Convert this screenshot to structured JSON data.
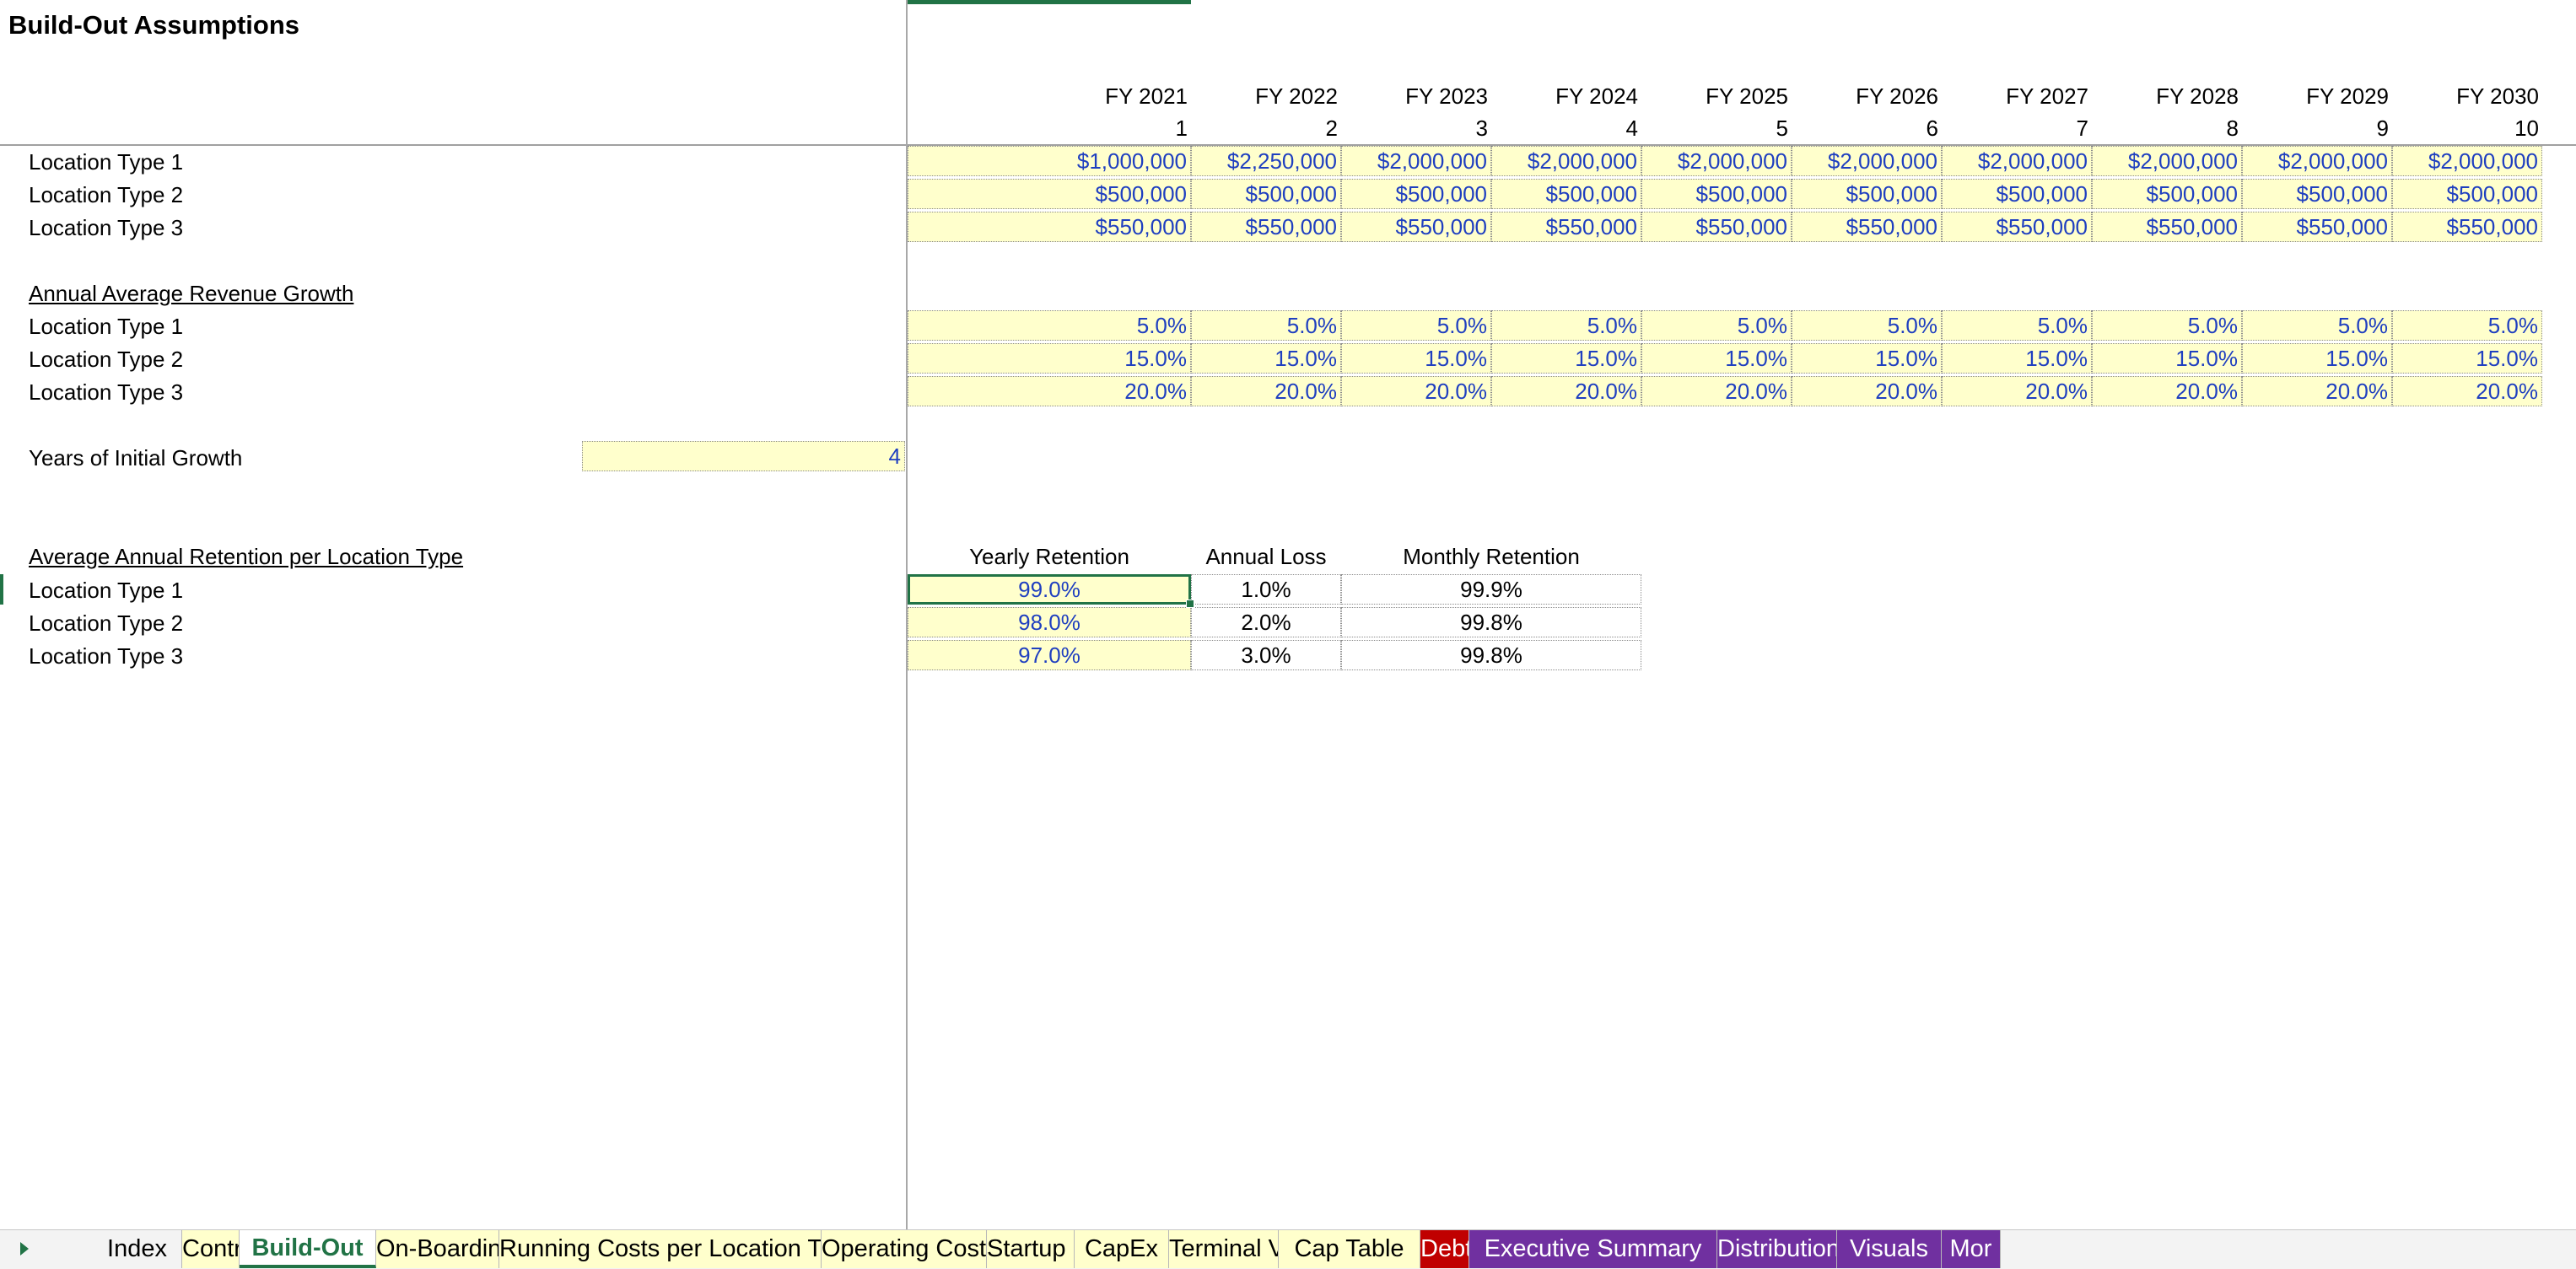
{
  "sheet": {
    "title": "Build-Out Assumptions",
    "fy_headers": [
      "FY 2021",
      "FY 2022",
      "FY 2023",
      "FY 2024",
      "FY 2025",
      "FY 2026",
      "FY 2027",
      "FY 2028",
      "FY 2029",
      "FY 2030"
    ],
    "year_numbers": [
      "1",
      "2",
      "3",
      "4",
      "5",
      "6",
      "7",
      "8",
      "9",
      "10"
    ],
    "revenue_section": {
      "rows": [
        {
          "label": "Location Type 1",
          "values": [
            "$1,000,000",
            "$2,250,000",
            "$2,000,000",
            "$2,000,000",
            "$2,000,000",
            "$2,000,000",
            "$2,000,000",
            "$2,000,000",
            "$2,000,000",
            "$2,000,000"
          ]
        },
        {
          "label": "Location Type 2",
          "values": [
            "$500,000",
            "$500,000",
            "$500,000",
            "$500,000",
            "$500,000",
            "$500,000",
            "$500,000",
            "$500,000",
            "$500,000",
            "$500,000"
          ]
        },
        {
          "label": "Location Type 3",
          "values": [
            "$550,000",
            "$550,000",
            "$550,000",
            "$550,000",
            "$550,000",
            "$550,000",
            "$550,000",
            "$550,000",
            "$550,000",
            "$550,000"
          ]
        }
      ]
    },
    "growth_section": {
      "heading": "Annual Average Revenue Growth",
      "rows": [
        {
          "label": "Location Type 1",
          "values": [
            "5.0%",
            "5.0%",
            "5.0%",
            "5.0%",
            "5.0%",
            "5.0%",
            "5.0%",
            "5.0%",
            "5.0%",
            "5.0%"
          ]
        },
        {
          "label": "Location Type 2",
          "values": [
            "15.0%",
            "15.0%",
            "15.0%",
            "15.0%",
            "15.0%",
            "15.0%",
            "15.0%",
            "15.0%",
            "15.0%",
            "15.0%"
          ]
        },
        {
          "label": "Location Type 3",
          "values": [
            "20.0%",
            "20.0%",
            "20.0%",
            "20.0%",
            "20.0%",
            "20.0%",
            "20.0%",
            "20.0%",
            "20.0%",
            "20.0%"
          ]
        }
      ]
    },
    "initial_growth": {
      "label": "Years of Initial Growth",
      "value": "4"
    },
    "retention_section": {
      "heading": "Average Annual Retention per Location Type",
      "columns": [
        "Yearly Retention",
        "Annual Loss",
        "Monthly Retention"
      ],
      "rows": [
        {
          "label": "Location Type 1",
          "yearly": "99.0%",
          "loss": "1.0%",
          "monthly": "99.9%"
        },
        {
          "label": "Location Type 2",
          "yearly": "98.0%",
          "loss": "2.0%",
          "monthly": "99.8%"
        },
        {
          "label": "Location Type 3",
          "yearly": "97.0%",
          "loss": "3.0%",
          "monthly": "99.8%"
        }
      ]
    }
  },
  "tabs": [
    {
      "label": "Index",
      "color": "#f3f3f3",
      "text": "#000000"
    },
    {
      "label": "Control",
      "color": "#ffffcc",
      "text": "#000000"
    },
    {
      "label": "Build-Out",
      "color": "#ffffff",
      "text": "#217346",
      "active": true
    },
    {
      "label": "On-Boarding Costs",
      "color": "#ffffcc",
      "text": "#000000"
    },
    {
      "label": "Running Costs per Location Type",
      "color": "#ffffcc",
      "text": "#000000"
    },
    {
      "label": "Operating Costs",
      "color": "#ffffcc",
      "text": "#000000"
    },
    {
      "label": "Startup Costs",
      "color": "#ffffcc",
      "text": "#000000"
    },
    {
      "label": "CapEx",
      "color": "#ffffcc",
      "text": "#000000"
    },
    {
      "label": "Terminal Value",
      "color": "#ffffcc",
      "text": "#000000"
    },
    {
      "label": "Cap Table",
      "color": "#ffffcc",
      "text": "#000000"
    },
    {
      "label": "Debt",
      "color": "#c00000",
      "text": "#ffffff"
    },
    {
      "label": "Executive Summary",
      "color": "#7030a0",
      "text": "#ffffff"
    },
    {
      "label": "Distributions",
      "color": "#7030a0",
      "text": "#ffffff"
    },
    {
      "label": "Visuals",
      "color": "#7030a0",
      "text": "#ffffff"
    },
    {
      "label": "Mor",
      "color": "#7030a0",
      "text": "#ffffff"
    }
  ],
  "colors": {
    "accent": "#217346",
    "input_fill": "#ffffcc",
    "input_text": "#1f3fc0"
  },
  "icons": {
    "tab_nav": "triangle-right-icon"
  }
}
